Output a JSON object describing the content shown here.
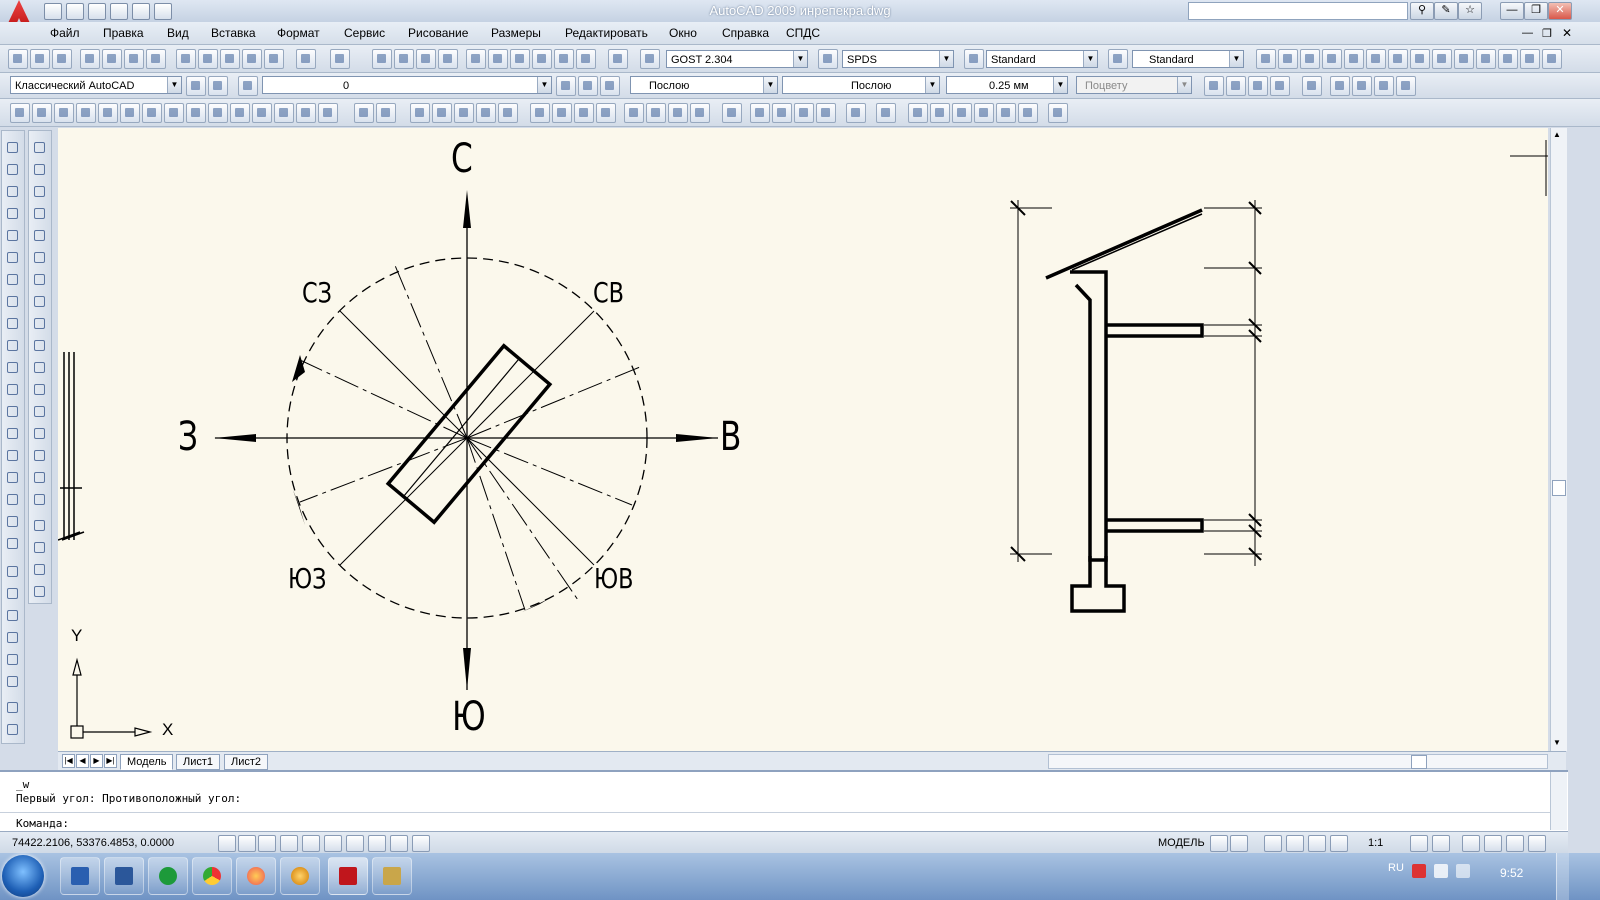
{
  "window": {
    "title": "AutoCAD 2009 инрепекра.dwg"
  },
  "menu": [
    "Файл",
    "Правка",
    "Вид",
    "Вставка",
    "Формат",
    "Сервис",
    "Рисование",
    "Размеры",
    "Редактировать",
    "Окно",
    "Справка",
    "СПДС"
  ],
  "toolbar2": {
    "textstyle": "GOST 2.304",
    "dimstyle": "SPDS",
    "tablestyle": "Standard",
    "multileaderstyle": "Standard"
  },
  "toolbar3": {
    "workspace": "Классический AutoCAD",
    "layer": "0",
    "color": "Послою",
    "linetype": "Послою",
    "lineweight": "0.25 мм",
    "plotstyle": "Поцвету"
  },
  "drawing": {
    "compass": {
      "north": "С",
      "south": "Ю",
      "east": "В",
      "west": "З",
      "nw": "СЗ",
      "ne": "СВ",
      "sw": "ЮЗ",
      "se": "ЮВ"
    },
    "ucs": {
      "x": "X",
      "y": "Y"
    }
  },
  "tabs": [
    "Модель",
    "Лист1",
    "Лист2"
  ],
  "command": {
    "line1": "_w",
    "line2": "Первый угол: Противоположный угол:",
    "prompt": "Команда:"
  },
  "status": {
    "coords": "74422.2106, 53376.4853, 0.0000",
    "space": "МОДЕЛЬ",
    "scale": "1:1"
  },
  "taskbar": {
    "lang": "RU",
    "time": "9:52"
  }
}
